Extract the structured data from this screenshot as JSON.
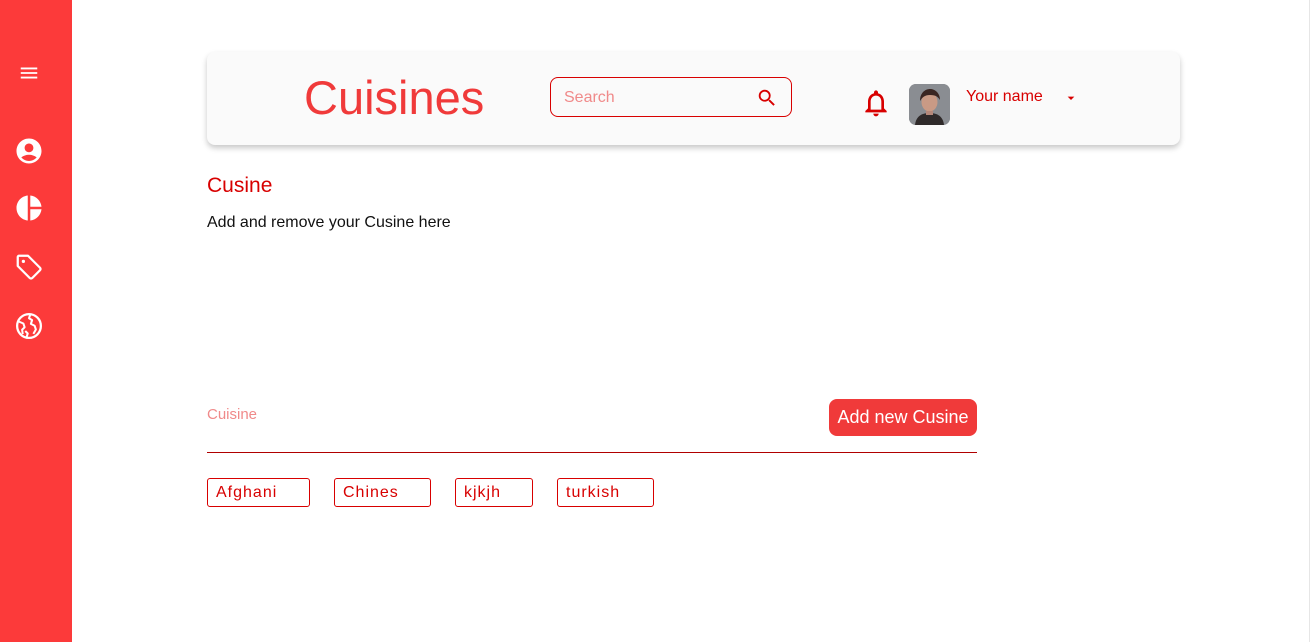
{
  "sidebar": {
    "items": [
      {
        "icon": "menu-icon"
      },
      {
        "icon": "account-circle-icon"
      },
      {
        "icon": "pie-chart-icon"
      },
      {
        "icon": "tag-icon"
      },
      {
        "icon": "globe-icon"
      }
    ]
  },
  "header": {
    "title": "Cuisines",
    "search_placeholder": "Search",
    "user_name": "Your name"
  },
  "main": {
    "section_title": "Cusine",
    "section_desc": "Add and remove your Cusine here",
    "field_label": "Cuisine",
    "add_button_label": "Add new Cusine",
    "chips": [
      "Afghani",
      "Chines",
      "kjkjh",
      "turkish"
    ]
  },
  "colors": {
    "sidebar_bg": "#fc3a3a",
    "accent": "#d80000",
    "button_bg": "#f03a3a"
  }
}
